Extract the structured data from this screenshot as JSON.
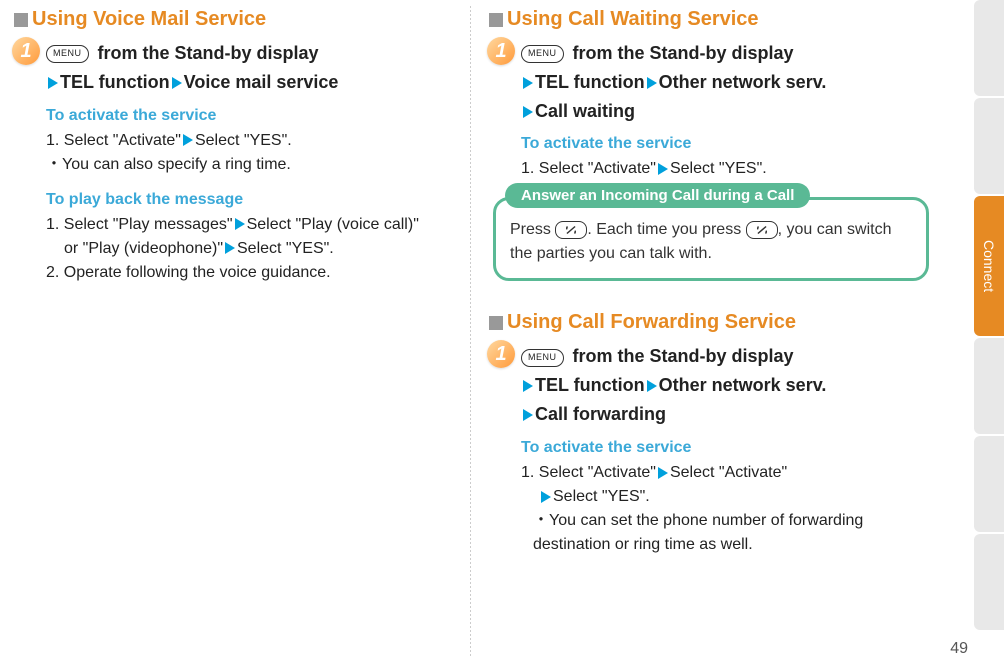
{
  "pageNumber": "49",
  "sideTabLabel": "Connect",
  "voiceMail": {
    "title": "Using Voice Mail Service",
    "stepNum": "1",
    "menuLabel": "MENU",
    "stepLine1": " from the Stand-by display",
    "nav1": "TEL function",
    "nav2": "Voice mail service",
    "activateHead": "To activate the service",
    "activateLine": "1. Select \"Activate\"",
    "activateLine2": "Select \"YES\".",
    "activateNote": " ・You can also specify a ring time.",
    "playHead": "To play back the message",
    "playLine1a": "1. Select \"Play messages\"",
    "playLine1b": "Select \"Play (voice call)\" ",
    "playLine1c": "or \"Play (videophone)\"",
    "playLine1d": "Select \"YES\".",
    "playLine2": "2. Operate following the voice guidance."
  },
  "callWaiting": {
    "title": "Using Call Waiting Service",
    "stepNum": "1",
    "menuLabel": "MENU",
    "stepLine1": " from the Stand-by display",
    "nav1": "TEL function",
    "nav2": "Other network serv.",
    "nav3": "Call waiting",
    "activateHead": "To activate the service",
    "activateLine": "1. Select \"Activate\"",
    "activateLine2": "Select \"YES\".",
    "pillLabel": "Answer an Incoming Call during a Call",
    "infoLine1a": "Press ",
    "infoLine1b": ". Each time you press ",
    "infoLine1c": ", you can switch the parties you can talk with."
  },
  "callForwarding": {
    "title": "Using Call Forwarding Service",
    "stepNum": "1",
    "menuLabel": "MENU",
    "stepLine1": " from the Stand-by display",
    "nav1": "TEL function",
    "nav2": "Other network serv.",
    "nav3": "Call forwarding",
    "activateHead": "To activate the service",
    "actLine1a": "1. Select \"Activate\"",
    "actLine1b": "Select \"Activate\"",
    "actLine1c": "Select \"YES\".",
    "actNote": " ・You can set the phone number of forwarding destination or ring time as well."
  }
}
